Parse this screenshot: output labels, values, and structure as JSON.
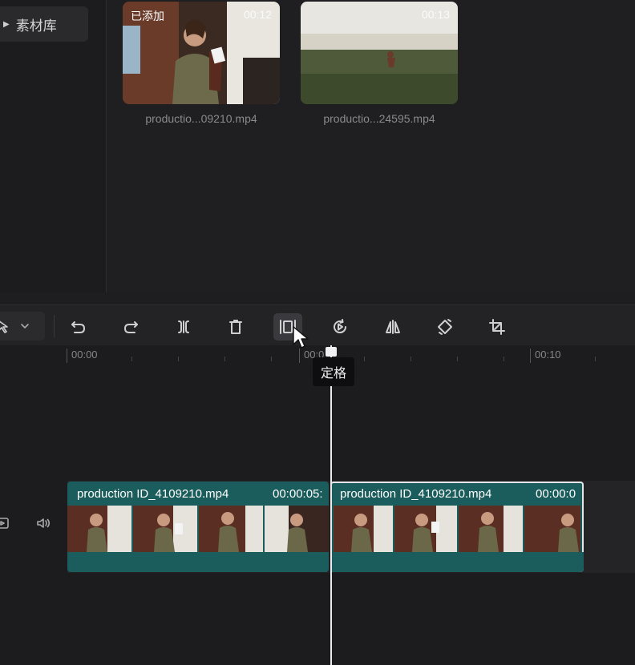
{
  "sidebar": {
    "library_label": "素材库"
  },
  "media": [
    {
      "tag": "已添加",
      "duration": "00:12",
      "name": "productio...09210.mp4"
    },
    {
      "tag": "",
      "duration": "00:13",
      "name": "productio...24595.mp4"
    }
  ],
  "toolbar": {
    "tools": [
      "select",
      "undo",
      "redo",
      "split",
      "delete",
      "freeze-frame",
      "reverse",
      "mirror",
      "rotate",
      "crop"
    ]
  },
  "timeline": {
    "ruler": [
      "00:00",
      "00:0",
      "00:10"
    ],
    "clips": [
      {
        "title": "production ID_4109210.mp4",
        "duration": "00:00:05:"
      },
      {
        "title": "production ID_4109210.mp4",
        "duration": "00:00:0"
      }
    ]
  },
  "tooltip": "定格",
  "colors": {
    "clip": "#1b5c5c",
    "background": "#1e1e20",
    "playhead": "#e9e9eb"
  }
}
